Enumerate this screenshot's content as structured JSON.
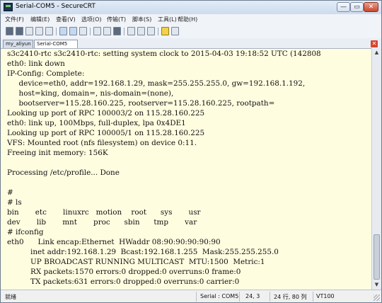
{
  "window": {
    "title": "Serial-COM5 - SecureCRT"
  },
  "caption": {
    "minimize": "—",
    "maximize": "▭",
    "close": "✕"
  },
  "menu": [
    "文件(F)",
    "编辑(E)",
    "查看(V)",
    "选项(O)",
    "传输(T)",
    "脚本(S)",
    "工具(L)",
    "帮助(H)"
  ],
  "tabs": [
    {
      "label": "my_aliyun"
    },
    {
      "label": "Serial-COM5"
    }
  ],
  "tab_close": "✕",
  "toolbar_icons": [
    "connect-icon",
    "quick-connect-icon",
    "connect-tab-icon",
    "reconnect-icon",
    "disconnect-icon",
    "copy-icon",
    "paste-icon",
    "find-icon",
    "session-options-icon",
    "print-icon",
    "print-screen-icon",
    "settings-icon",
    "keymap-icon",
    "sftp-icon",
    "help-icon",
    "options-icon"
  ],
  "terminal": {
    "lines": [
      "s3c2410-rtc s3c2410-rtc: setting system clock to 2015-04-03 19:18:52 UTC (142808",
      "eth0: link down",
      "IP-Config: Complete:",
      "     device=eth0, addr=192.168.1.29, mask=255.255.255.0, gw=192.168.1.192,",
      "     host=king, domain=, nis-domain=(none),",
      "     bootserver=115.28.160.225, rootserver=115.28.160.225, rootpath=",
      "Looking up port of RPC 100003/2 on 115.28.160.225",
      "eth0: link up, 100Mbps, full-duplex, lpa 0x4DE1",
      "Looking up port of RPC 100005/1 on 115.28.160.225",
      "VFS: Mounted root (nfs filesystem) on device 0:11.",
      "Freeing init memory: 156K",
      "",
      "Processing /etc/profile... Done",
      "",
      "#",
      "# ls",
      "bin       etc       linuxrc   motion    root      sys       usr",
      "dev       lib       mnt       proc      sbin      tmp       var",
      "# ifconfig",
      "eth0      Link encap:Ethernet  HWaddr 08:90:90:90:90:90",
      "          inet addr:192.168.1.29  Bcast:192.168.1.255  Mask:255.255.255.0",
      "          UP BROADCAST RUNNING MULTICAST  MTU:1500  Metric:1",
      "          RX packets:1570 errors:0 dropped:0 overruns:0 frame:0",
      "          TX packets:631 errors:0 dropped:0 overruns:0 carrier:0"
    ]
  },
  "scrollbar": {
    "up": "▲",
    "down": "▼"
  },
  "status": {
    "ready": "就绪",
    "session": "Serial : COM5",
    "position": "24,  3",
    "size": "24 行, 80 列",
    "emulation": "VT100"
  }
}
